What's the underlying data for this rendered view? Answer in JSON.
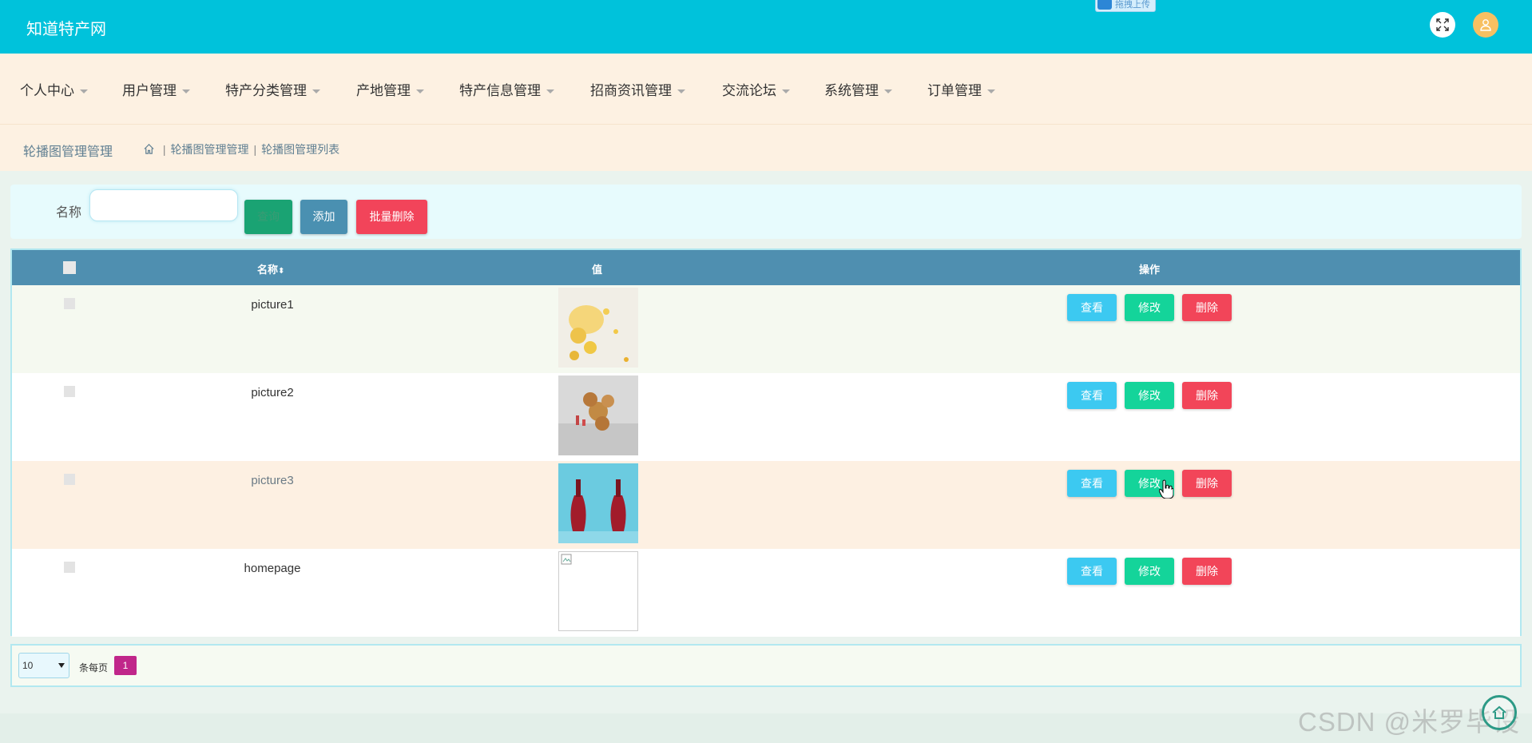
{
  "header": {
    "site_title": "知道特产网",
    "upload_badge": "拖拽上传",
    "expand_icon": "expand-icon",
    "user_icon": "user-icon",
    "bg_color": "#00c2db"
  },
  "nav": {
    "items": [
      {
        "label": "个人中心"
      },
      {
        "label": "用户管理"
      },
      {
        "label": "特产分类管理"
      },
      {
        "label": "产地管理"
      },
      {
        "label": "特产信息管理"
      },
      {
        "label": "招商资讯管理"
      },
      {
        "label": "交流论坛"
      },
      {
        "label": "系统管理"
      },
      {
        "label": "订单管理"
      }
    ]
  },
  "breadcrumb": {
    "title": "轮播图管理管理",
    "items": [
      "轮播图管理管理",
      "轮播图管理列表"
    ],
    "separator": "|"
  },
  "search": {
    "label": "名称",
    "value": "",
    "search_button": "查询",
    "add_button": "添加",
    "batch_delete_button": "批量删除"
  },
  "table": {
    "columns": [
      "名称",
      "值",
      "操作"
    ],
    "sort_icon": "⬍",
    "rows": [
      {
        "name": "picture1",
        "image": "yellow-food-photo",
        "view": "查看",
        "edit": "修改",
        "delete": "删除"
      },
      {
        "name": "picture2",
        "image": "walnut-photo",
        "view": "查看",
        "edit": "修改",
        "delete": "删除"
      },
      {
        "name": "picture3",
        "image": "red-bottles-photo",
        "view": "查看",
        "edit": "修改",
        "delete": "删除"
      },
      {
        "name": "homepage",
        "image": "broken-image",
        "view": "查看",
        "edit": "修改",
        "delete": "删除"
      }
    ],
    "header_color": "#4f8fb0"
  },
  "pagination": {
    "page_size": "10",
    "per_page_label": "条每页",
    "current_page": "1"
  },
  "watermark": "CSDN @米罗毕设"
}
